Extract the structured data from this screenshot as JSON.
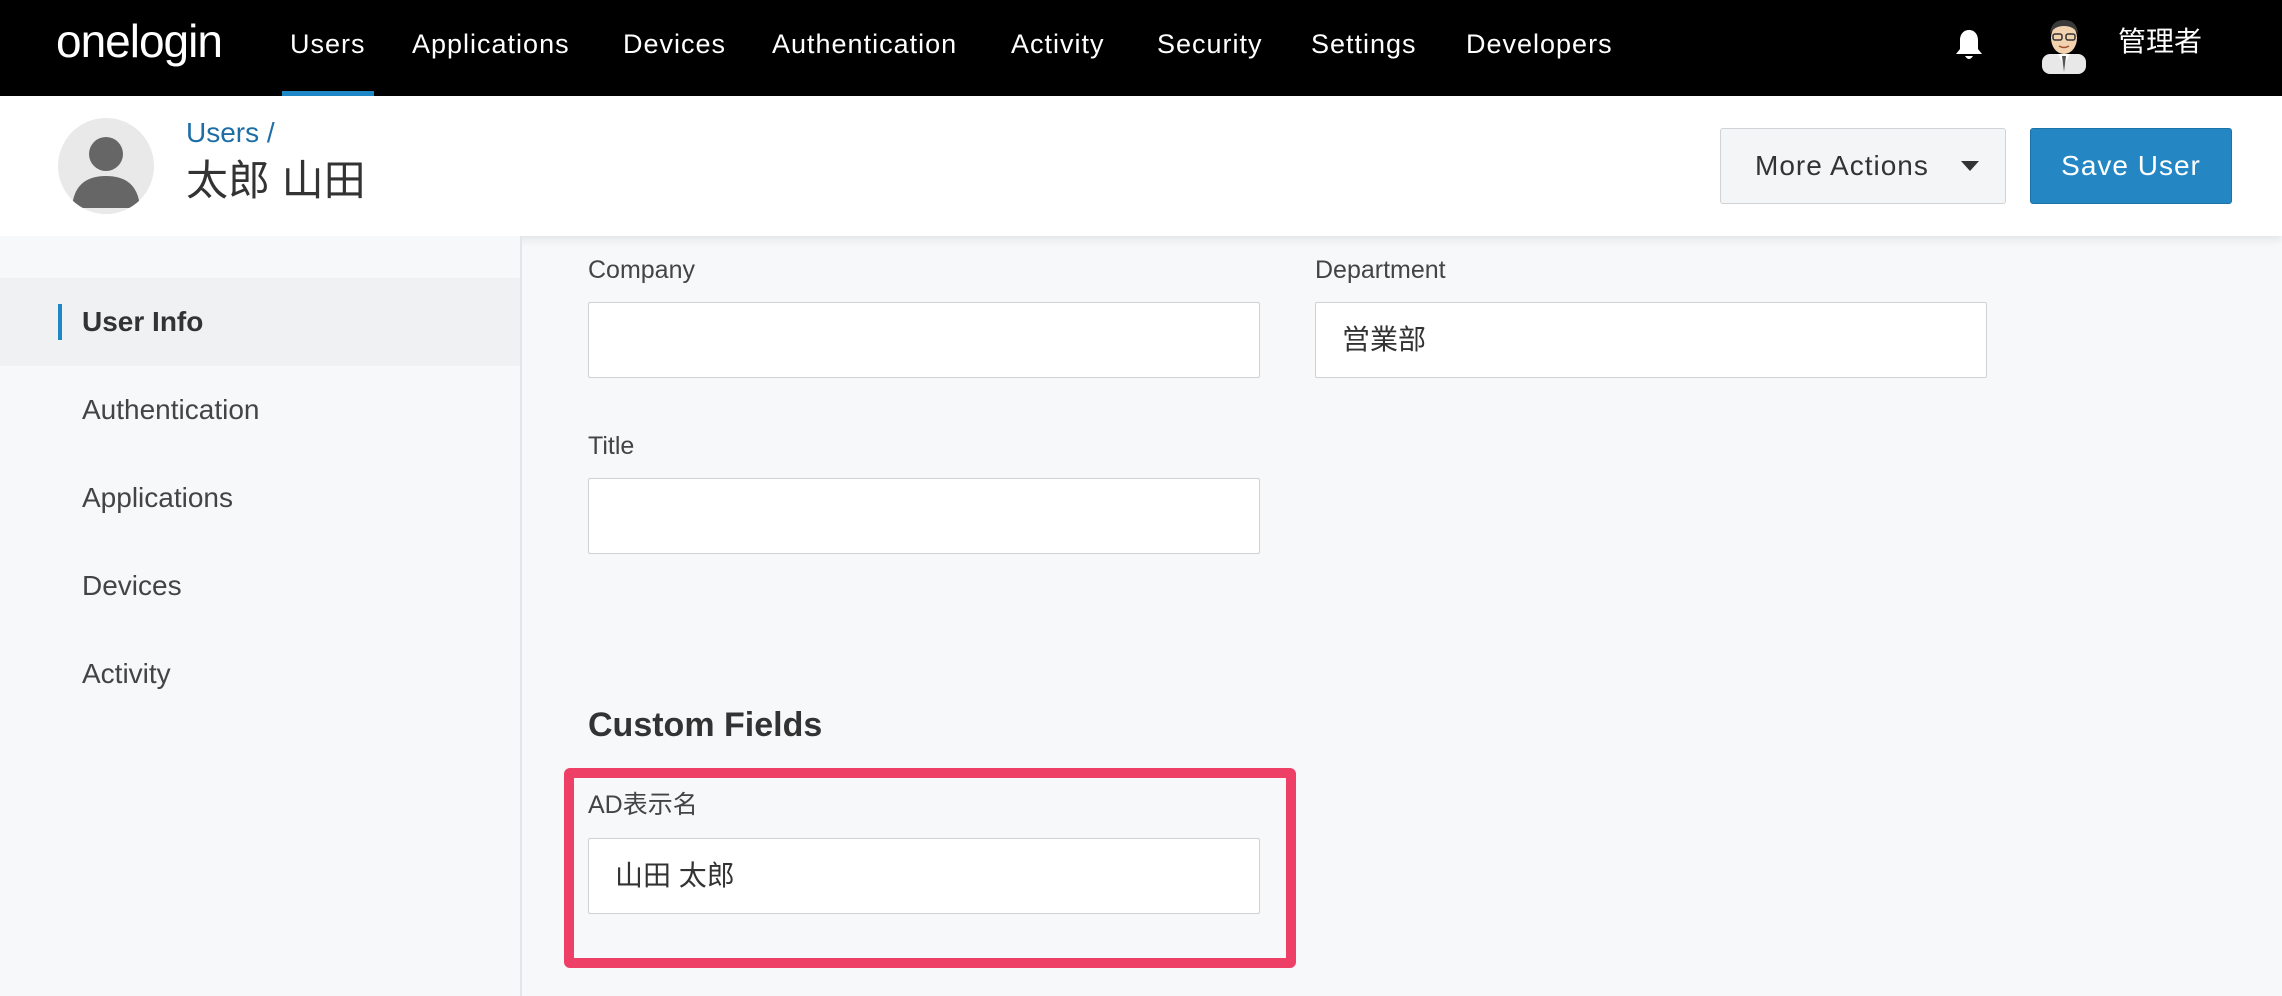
{
  "topnav": {
    "logo": "onelogin",
    "items": [
      "Users",
      "Applications",
      "Devices",
      "Authentication",
      "Activity",
      "Security",
      "Settings",
      "Developers"
    ],
    "active": "Users",
    "admin_name": "管理者"
  },
  "header": {
    "breadcrumb": "Users /",
    "title": "太郎 山田",
    "more_actions_label": "More Actions",
    "save_label": "Save User"
  },
  "sidebar": {
    "items": [
      "User Info",
      "Authentication",
      "Applications",
      "Devices",
      "Activity"
    ],
    "active": "User Info"
  },
  "form": {
    "company": {
      "label": "Company",
      "value": ""
    },
    "department": {
      "label": "Department",
      "value": "営業部"
    },
    "title_field": {
      "label": "Title",
      "value": ""
    },
    "custom_fields_heading": "Custom Fields",
    "ad_display_name": {
      "label": "AD表示名",
      "value": "山田 太郎"
    }
  },
  "colors": {
    "accent": "#1e88c7",
    "save_button": "#2487c4",
    "highlight": "#ee3f66",
    "nav_bg": "#000000"
  },
  "icons": {
    "notification": "bell-icon",
    "admin_avatar": "avatar-icon",
    "user_avatar": "user-avatar-icon",
    "dropdown": "caret-down-icon"
  }
}
